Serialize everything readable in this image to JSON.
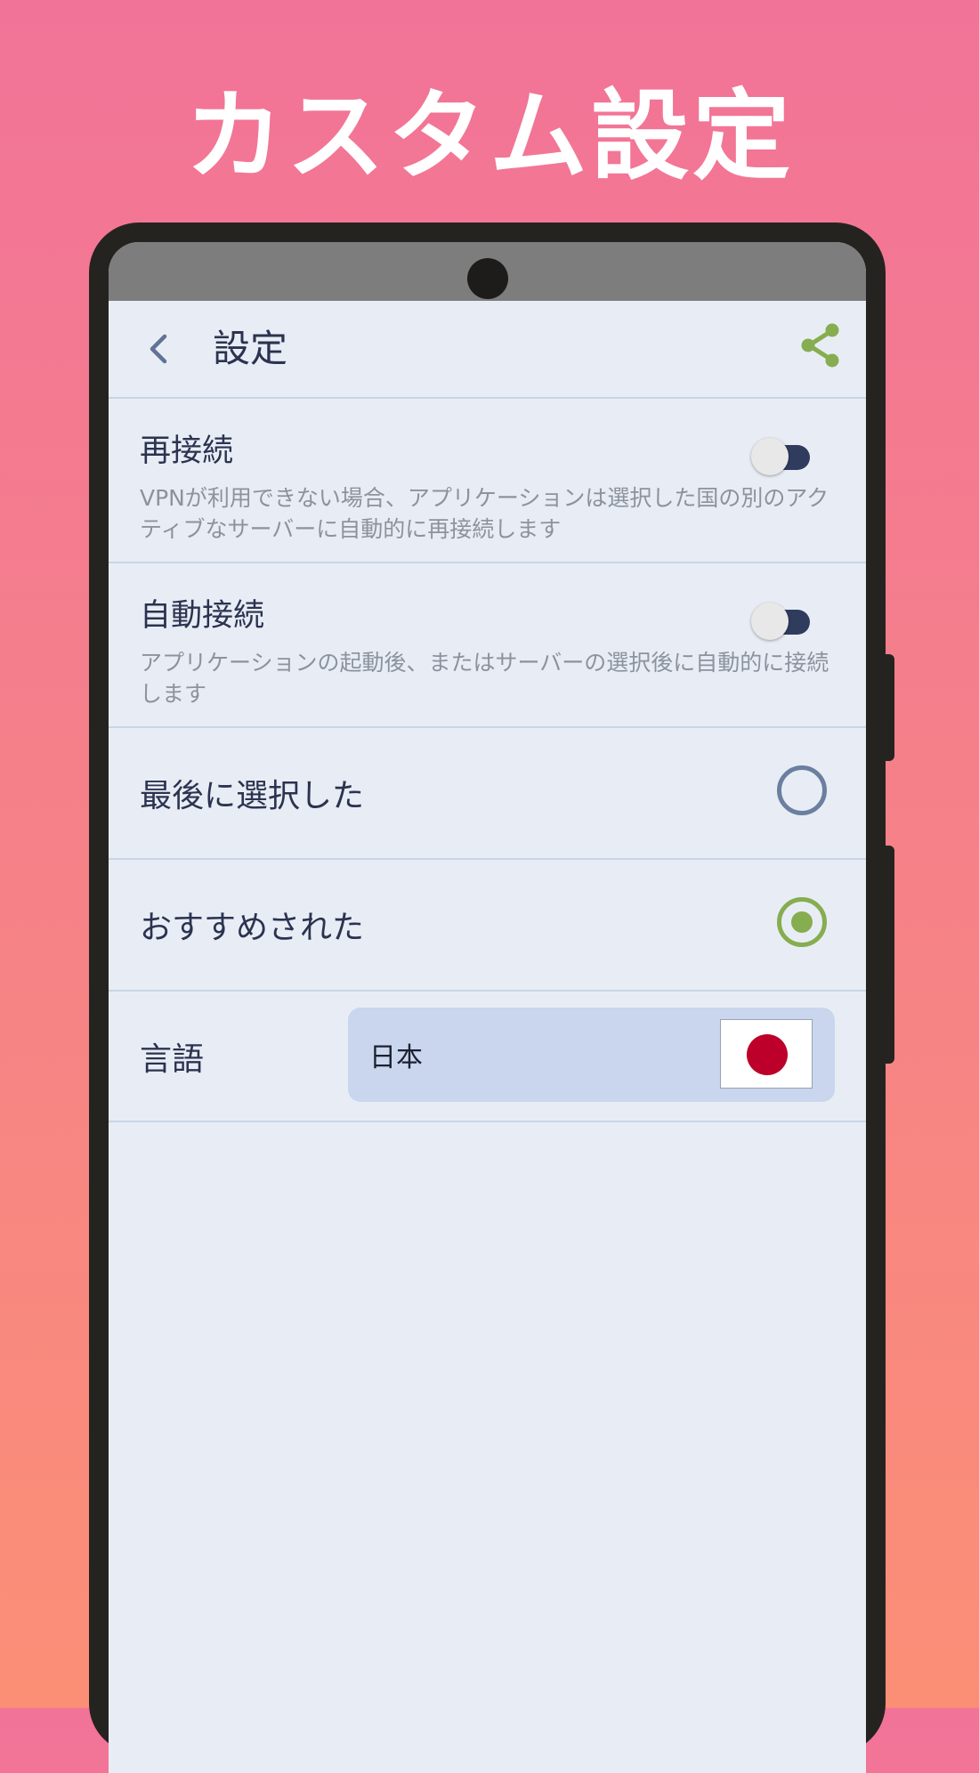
{
  "promo": {
    "headline": "カスタム設定"
  },
  "app_bar": {
    "title": "設定",
    "back_icon": "chevron-left-icon",
    "share_icon": "share-icon"
  },
  "settings": {
    "reconnect": {
      "title": "再接続",
      "description": "VPNが利用できない場合、アプリケーションは選択した国の別のアクティブなサーバーに自動的に再接続します",
      "enabled": false
    },
    "auto_connect": {
      "title": "自動接続",
      "description": "アプリケーションの起動後、またはサーバーの選択後に自動的に接続します",
      "enabled": false
    },
    "server_choice": [
      {
        "label": "最後に選択した",
        "selected": false
      },
      {
        "label": "おすすめされた",
        "selected": true
      }
    ],
    "language": {
      "label": "言語",
      "value": "日本",
      "flag_icon": "japan-flag-icon"
    }
  },
  "colors": {
    "background_top": "#f27398",
    "background_bottom": "#fb8f76",
    "screen_bg": "#e8edf5",
    "accent_green": "#86ad4f",
    "toggle_track": "#2f3c5e",
    "radio_unselected": "#6b7fa0",
    "language_chip": "#c9d6ed",
    "flag_red": "#bd0029"
  }
}
